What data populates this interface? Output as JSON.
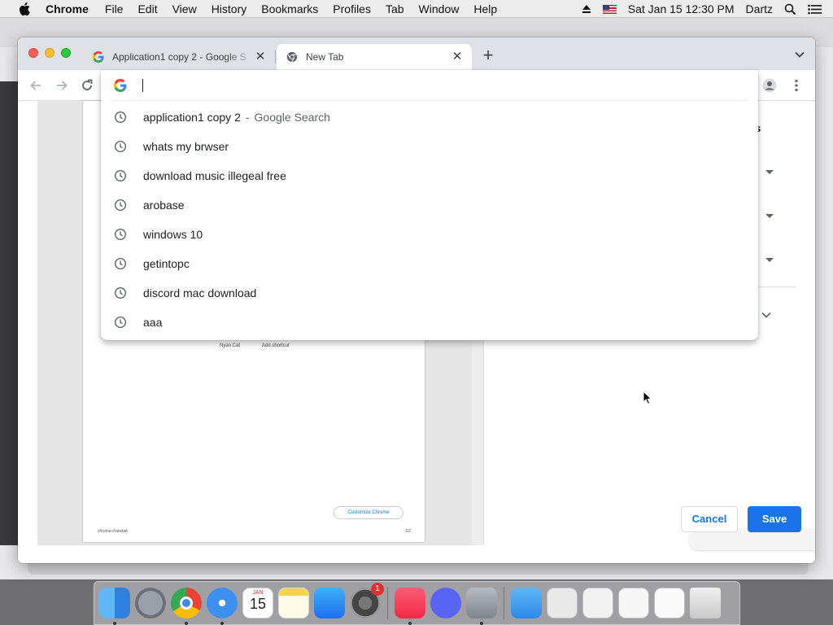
{
  "menubar": {
    "app_name": "Chrome",
    "items": [
      "File",
      "Edit",
      "View",
      "History",
      "Bookmarks",
      "Profiles",
      "Tab",
      "Window",
      "Help"
    ],
    "clock": "Sat Jan 15  12:30 PM",
    "user": "Dartz"
  },
  "tabs": [
    {
      "title": "Application1 copy 2 - Google S",
      "favicon": "google-g-icon",
      "active": false
    },
    {
      "title": "New Tab",
      "favicon": "chrome-icon",
      "active": true
    }
  ],
  "omnibox": {
    "value": "",
    "suggestions": [
      {
        "text": "application1 copy 2",
        "source": "Google Search",
        "icon": "history-clock-icon"
      },
      {
        "text": "whats my brwser",
        "source": "",
        "icon": "history-clock-icon"
      },
      {
        "text": "download music illegeal free",
        "source": "",
        "icon": "history-clock-icon"
      },
      {
        "text": "arobase",
        "source": "",
        "icon": "history-clock-icon"
      },
      {
        "text": "windows 10",
        "source": "",
        "icon": "history-clock-icon"
      },
      {
        "text": "getintopc",
        "source": "",
        "icon": "history-clock-icon"
      },
      {
        "text": "discord mac download",
        "source": "",
        "icon": "history-clock-icon"
      },
      {
        "text": "aaa",
        "source": "",
        "icon": "history-clock-icon"
      }
    ],
    "suggestion_separator": "-"
  },
  "print_preview": {
    "shortcut_1": "Nyan Cat",
    "shortcut_2": "Add shortcut",
    "customize_label": "Customize Chrome",
    "footer_left": "chrome://newtab",
    "footer_right": "1/2"
  },
  "print_settings": {
    "pages_label_partial": "ges",
    "cancel_label": "Cancel",
    "save_label": "Save"
  },
  "dock": {
    "items": [
      "Finder",
      "Launchpad",
      "Google Chrome",
      "Safari",
      "Calendar",
      "Notes",
      "App Store",
      "System Preferences",
      "Music",
      "Discord",
      "Utilities",
      "Applications",
      "Downloads",
      "Document",
      "Folder",
      "Recent",
      "Trash"
    ],
    "calendar_month": "JAN",
    "calendar_day": "15",
    "system_prefs_badge": "1"
  },
  "colors": {
    "accent": "#1a73e8",
    "tabstrip": "#dee1e6",
    "traffic_close": "#fe5f57",
    "traffic_min": "#febc2e",
    "traffic_max": "#28c840"
  }
}
